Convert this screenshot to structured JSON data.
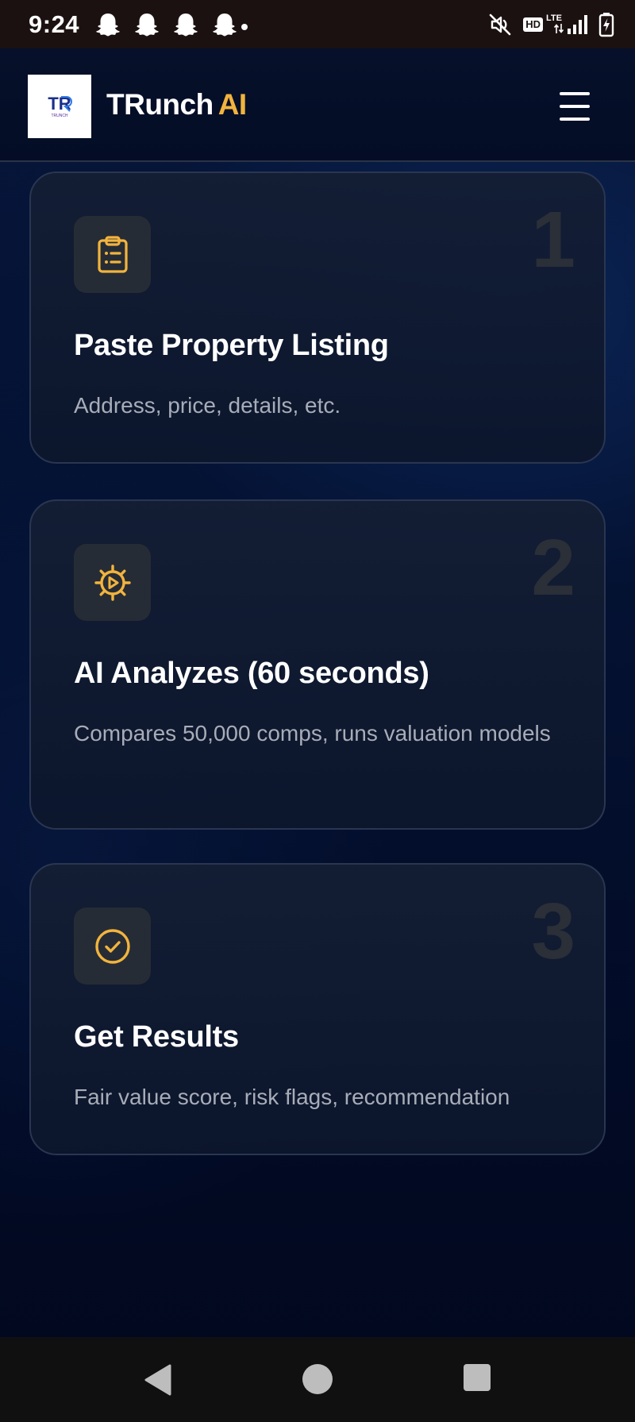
{
  "status_bar": {
    "time": "9:24",
    "notification_icons": [
      "ghost-icon",
      "ghost-icon",
      "ghost-icon",
      "ghost-icon"
    ],
    "hd_label": "HD",
    "network_label": "LTE",
    "icons": [
      "mute-icon",
      "signal-icon",
      "battery-charging-icon"
    ]
  },
  "header": {
    "logo_text": "TR",
    "logo_subtext": "TRUNCH",
    "brand_main": "TRunch",
    "brand_accent": "AI",
    "menu_icon": "hamburger-menu-icon"
  },
  "colors": {
    "accent": "#f2b43e",
    "card_border": "#2a3650",
    "text_muted": "#a7adb8",
    "step_number": "#2a2f38"
  },
  "steps": [
    {
      "number": "1",
      "icon": "clipboard-icon",
      "title": "Paste Property Listing",
      "description": "Address, price, details, etc."
    },
    {
      "number": "2",
      "icon": "gear-play-icon",
      "title": "AI Analyzes (60 seconds)",
      "description": "Compares 50,000 comps, runs valuation models"
    },
    {
      "number": "3",
      "icon": "check-circle-icon",
      "title": "Get Results",
      "description": "Fair value score, risk flags, recommendation"
    }
  ],
  "nav_bar": {
    "icons": [
      "back-icon",
      "home-icon",
      "recents-icon"
    ]
  }
}
